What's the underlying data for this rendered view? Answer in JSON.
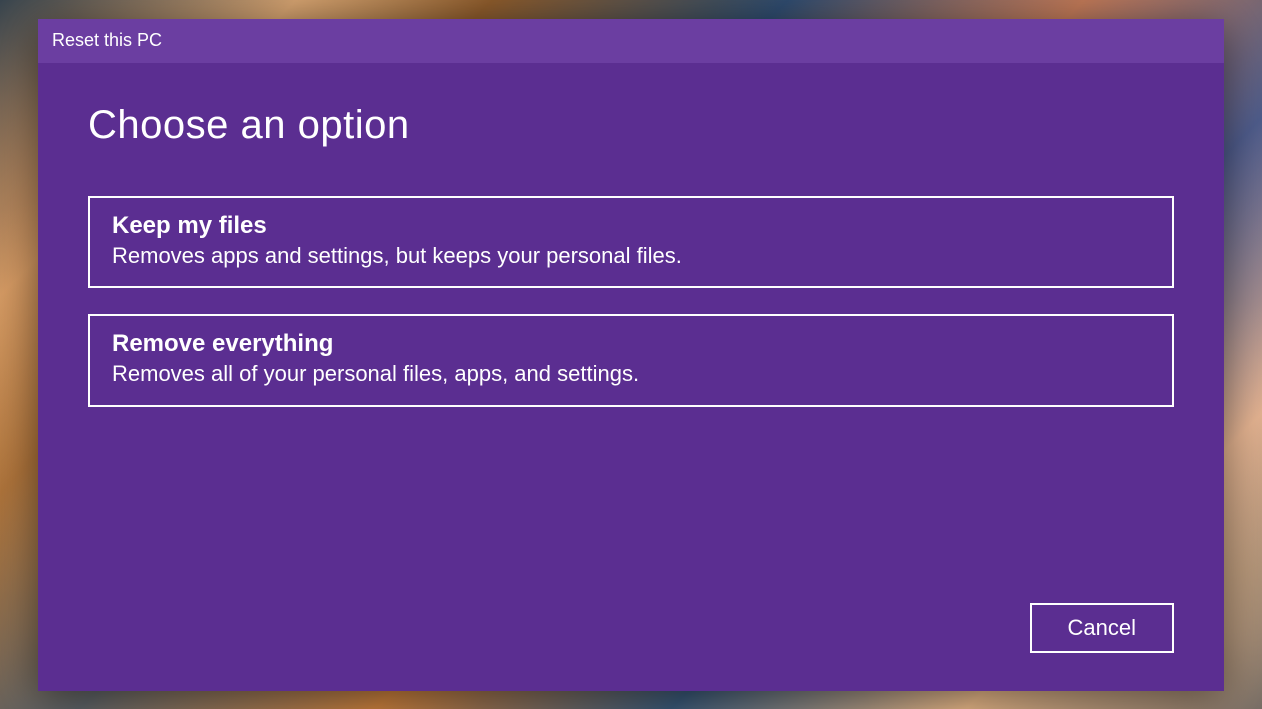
{
  "window": {
    "title": "Reset this PC"
  },
  "main": {
    "heading": "Choose an option",
    "options": [
      {
        "title": "Keep my files",
        "description": "Removes apps and settings, but keeps your personal files."
      },
      {
        "title": "Remove everything",
        "description": "Removes all of your personal files, apps, and settings."
      }
    ]
  },
  "footer": {
    "cancel_label": "Cancel"
  },
  "colors": {
    "dialog_bg": "#5b2e91",
    "title_bar_bg": "#6b3ea1",
    "text": "#ffffff",
    "border": "#ffffff"
  }
}
